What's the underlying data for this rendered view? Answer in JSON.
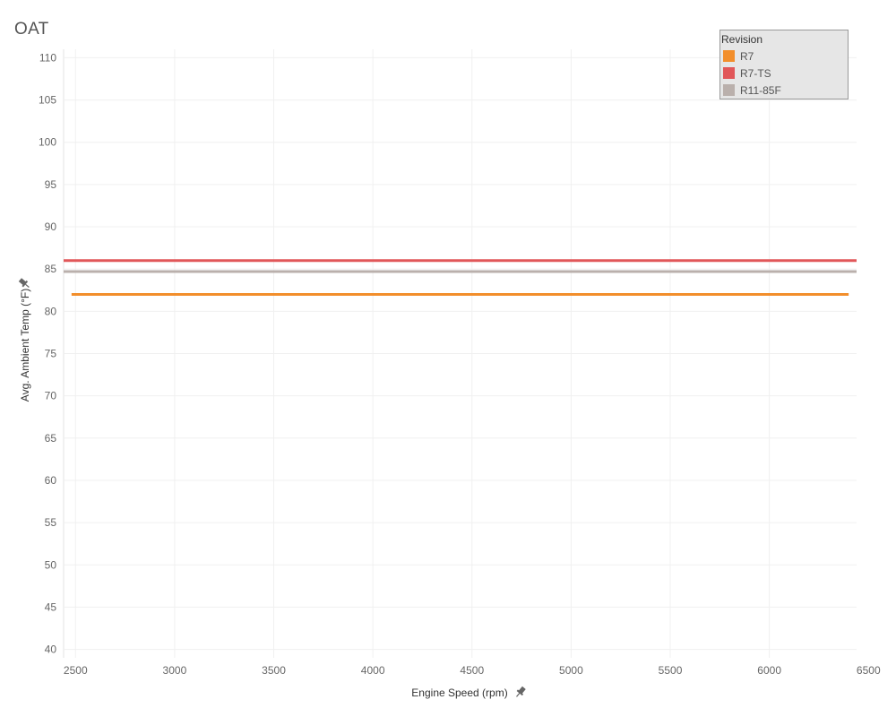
{
  "chart_data": {
    "type": "line",
    "title": "OAT",
    "xlabel": "Engine Speed (rpm)",
    "ylabel": "Avg. Ambient Temp (°F)",
    "xlim": [
      2440,
      6440
    ],
    "ylim": [
      39,
      111
    ],
    "xticks": [
      2500,
      3000,
      3500,
      4000,
      4500,
      5000,
      5500,
      6000,
      6500
    ],
    "yticks": [
      40,
      45,
      50,
      55,
      60,
      65,
      70,
      75,
      80,
      85,
      90,
      95,
      100,
      105,
      110
    ],
    "grid": true,
    "legend_position": "top-right",
    "legend_title": "Revision",
    "series": [
      {
        "name": "R7",
        "color": "#f28e2b",
        "x": [
          2480,
          6400
        ],
        "y": [
          82,
          82
        ]
      },
      {
        "name": "R7-TS",
        "color": "#e15759",
        "x": [
          2440,
          6450
        ],
        "y": [
          86,
          86
        ]
      },
      {
        "name": "R11-85F",
        "color": "#bab0ac",
        "x": [
          2440,
          6500
        ],
        "y": [
          84.7,
          84.7
        ]
      }
    ]
  },
  "icons": {
    "x_pin": "pin-icon",
    "y_pin": "pin-icon"
  }
}
